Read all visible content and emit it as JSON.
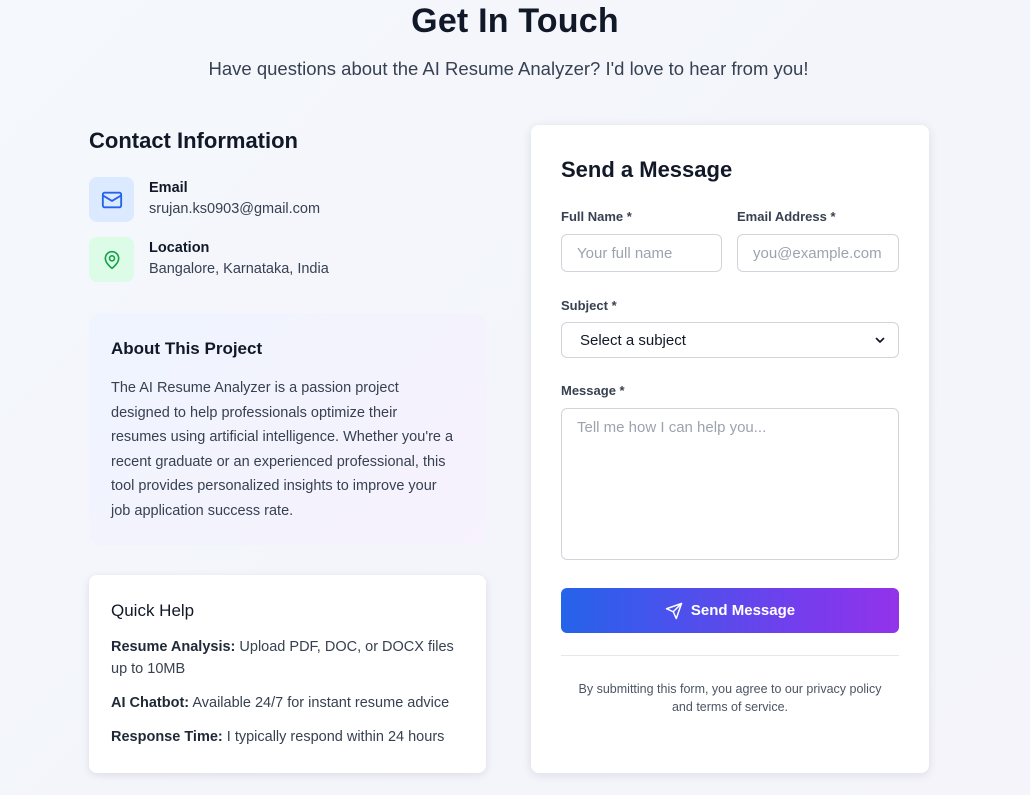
{
  "hero": {
    "title": "Get In Touch",
    "subtitle": "Have questions about the AI Resume Analyzer? I'd love to hear from you!"
  },
  "contact": {
    "heading": "Contact Information",
    "email": {
      "icon": "mail-icon",
      "title": "Email",
      "value": "srujan.ks0903@gmail.com"
    },
    "location": {
      "icon": "map-pin-icon",
      "title": "Location",
      "value": "Bangalore, Karnataka, India"
    }
  },
  "about": {
    "title": "About This Project",
    "lines": [
      "The AI Resume Analyzer is a passion project",
      "designed to help professionals optimize their",
      "resumes using artificial intelligence. Whether you're a",
      "recent graduate or an experienced professional, this",
      "tool provides personalized insights to improve your",
      "job application success rate."
    ]
  },
  "help": {
    "title": "Quick Help",
    "items": [
      {
        "label": "Resume Analysis:",
        "line1": " Upload PDF, DOC, or DOCX files",
        "line2": "up to 10MB"
      },
      {
        "label": "AI Chatbot:",
        "text": " Available 24/7 for instant resume advice"
      },
      {
        "label": "Response Time:",
        "text": " I typically respond within 24 hours"
      }
    ]
  },
  "form": {
    "title": "Send a Message",
    "full_name": {
      "label": "Full Name *",
      "placeholder": "Your full name",
      "value": ""
    },
    "email": {
      "label": "Email Address *",
      "placeholder": "you@example.com",
      "value": ""
    },
    "subject": {
      "label": "Subject *",
      "selected": "Select a subject"
    },
    "message": {
      "label": "Message *",
      "placeholder": "Tell me how I can help you...",
      "value": ""
    },
    "submit_label": "Send Message",
    "submit_icon": "send-icon",
    "disclaimer_line1": "By submitting this form, you agree to our privacy policy",
    "disclaimer_line2": "and terms of service."
  },
  "colors": {
    "accent_start": "#2563eb",
    "accent_end": "#9333ea",
    "email_icon_bg": "#dbeafe",
    "email_icon": "#2563eb",
    "location_icon_bg": "#dcfce7",
    "location_icon": "#16a34a"
  }
}
